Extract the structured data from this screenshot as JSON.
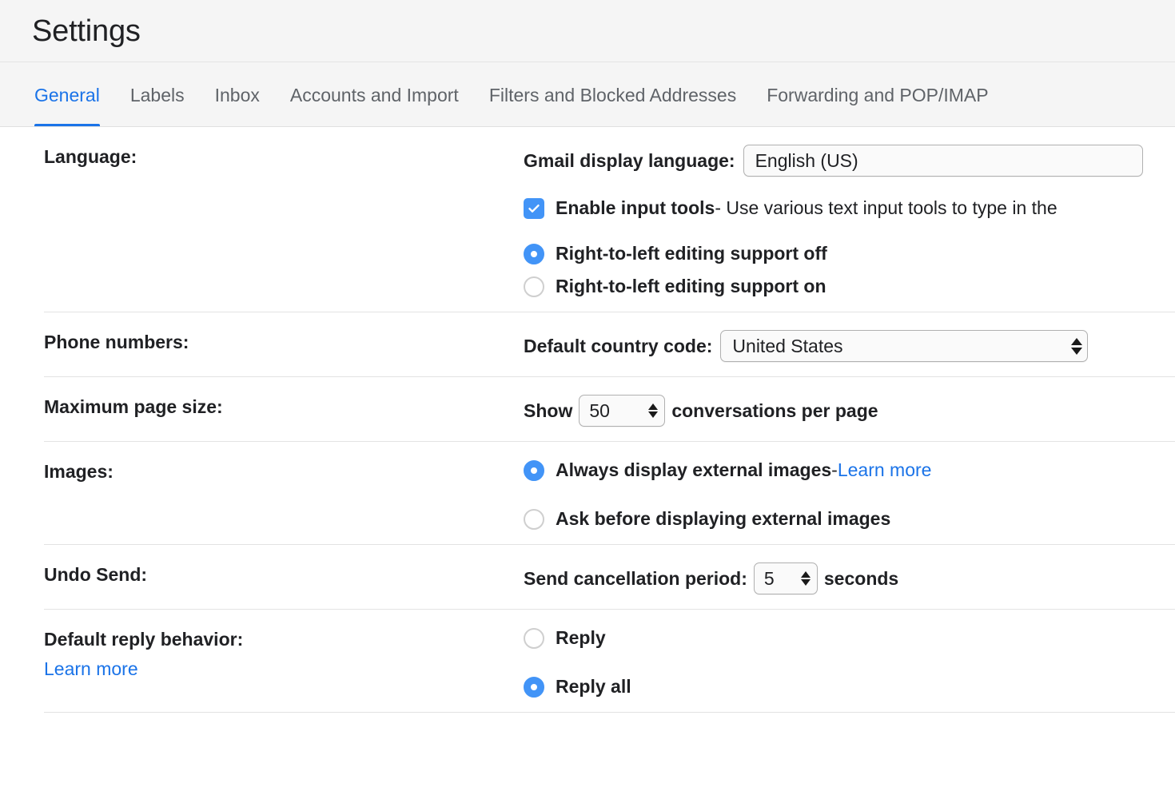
{
  "header": {
    "title": "Settings"
  },
  "tabs": [
    {
      "label": "General",
      "active": true
    },
    {
      "label": "Labels",
      "active": false
    },
    {
      "label": "Inbox",
      "active": false
    },
    {
      "label": "Accounts and Import",
      "active": false
    },
    {
      "label": "Filters and Blocked Addresses",
      "active": false
    },
    {
      "label": "Forwarding and POP/IMAP",
      "active": false
    }
  ],
  "sections": {
    "language": {
      "label": "Language:",
      "display_language_label": "Gmail display language:",
      "display_language_value": "English (US)",
      "input_tools": {
        "checked": true,
        "strong_label": "Enable input tools",
        "description": " - Use various text input tools to type in the"
      },
      "rtl_off": {
        "label": "Right-to-left editing support off",
        "selected": true
      },
      "rtl_on": {
        "label": "Right-to-left editing support on",
        "selected": false
      }
    },
    "phone_numbers": {
      "label": "Phone numbers:",
      "country_code_label": "Default country code:",
      "country_code_value": "United States"
    },
    "maximum_page_size": {
      "label": "Maximum page size:",
      "show_label": "Show",
      "count_value": "50",
      "suffix_label": "conversations per page"
    },
    "images": {
      "label": "Images:",
      "always_display": {
        "label": "Always display external images",
        "separator": " - ",
        "link": "Learn more",
        "selected": true
      },
      "ask_before": {
        "label": "Ask before displaying external images",
        "selected": false
      }
    },
    "undo_send": {
      "label": "Undo Send:",
      "period_label": "Send cancellation period:",
      "period_value": "5",
      "seconds_label": "seconds"
    },
    "default_reply_behavior": {
      "label": "Default reply behavior:",
      "learn_more": "Learn more",
      "reply": {
        "label": "Reply",
        "selected": false
      },
      "reply_all": {
        "label": "Reply all",
        "selected": true
      }
    }
  },
  "colors": {
    "accent_blue": "#1a73e8",
    "control_blue": "#4294f7",
    "header_bg": "#f5f5f5",
    "text": "#202124",
    "muted_text": "#5f6368",
    "divider": "#e3e3e3"
  }
}
